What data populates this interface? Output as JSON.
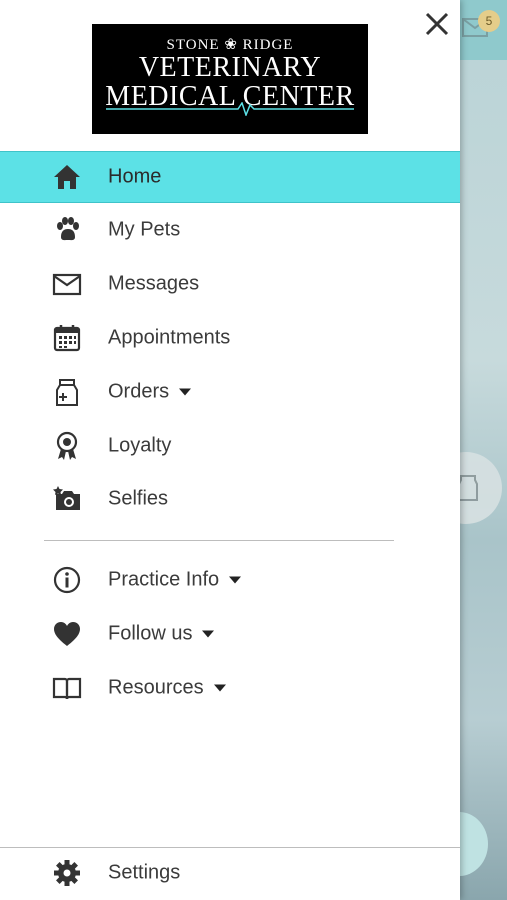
{
  "logo": {
    "line1": "STONE ❀ RIDGE",
    "line2": "VETERINARY",
    "line3": "MEDICAL CENTER",
    "colors": {
      "background": "#000000",
      "text": "#ffffff",
      "pulse": "#5ce1e6"
    }
  },
  "menu": {
    "items": [
      {
        "label": "Home",
        "icon": "home-icon",
        "active": true
      },
      {
        "label": "My Pets",
        "icon": "paw-icon"
      },
      {
        "label": "Messages",
        "icon": "envelope-icon"
      },
      {
        "label": "Appointments",
        "icon": "calendar-icon"
      },
      {
        "label": "Orders",
        "icon": "food-bag-icon",
        "dropdown": true
      },
      {
        "label": "Loyalty",
        "icon": "award-ribbon-icon"
      },
      {
        "label": "Selfies",
        "icon": "camera-icon"
      }
    ],
    "secondary": [
      {
        "label": "Practice Info",
        "icon": "info-icon",
        "dropdown": true
      },
      {
        "label": "Follow us",
        "icon": "heart-icon",
        "dropdown": true
      },
      {
        "label": "Resources",
        "icon": "book-icon",
        "dropdown": true
      }
    ],
    "settings": {
      "label": "Settings",
      "icon": "gear-icon"
    }
  },
  "background_app": {
    "notification_count": "5"
  },
  "colors": {
    "accent": "#5ce1e6",
    "text": "#3b3b3b",
    "icon": "#333333"
  }
}
